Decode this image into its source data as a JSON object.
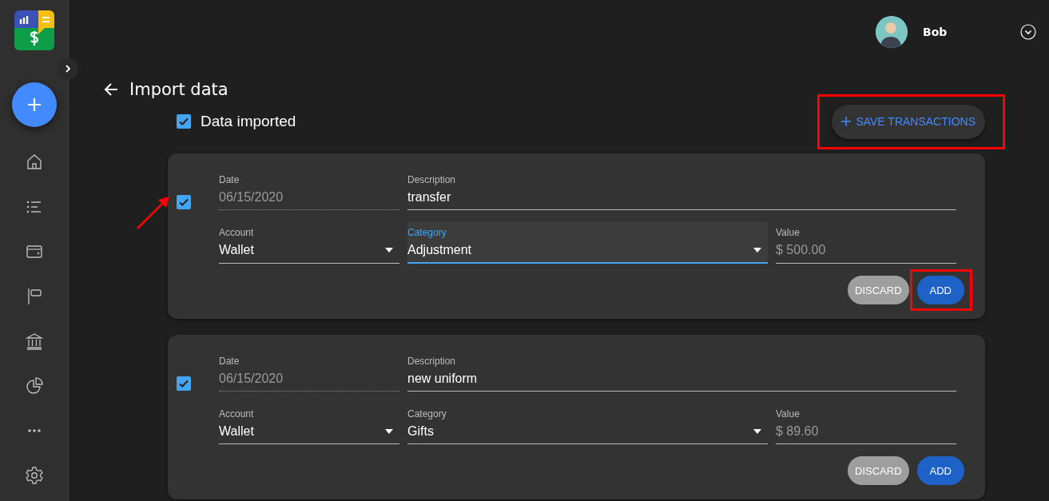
{
  "user": {
    "name": "Bob"
  },
  "page": {
    "title": "Import data"
  },
  "import_status": {
    "label": "Data imported",
    "checked": true
  },
  "save_button": {
    "label": "SAVE TRANSACTIONS",
    "highlighted": true
  },
  "transactions": [
    {
      "checked": true,
      "pointer_arrow": true,
      "rows": [
        [
          {
            "kind": "date",
            "label": "Date",
            "value": "06/15/2020",
            "focused": false
          },
          {
            "kind": "text",
            "label": "Description",
            "value": "transfer",
            "focused": false
          }
        ],
        [
          {
            "kind": "select",
            "label": "Account",
            "value": "Wallet",
            "focused": false
          },
          {
            "kind": "select",
            "label": "Category",
            "value": "Adjustment",
            "focused": true
          },
          {
            "kind": "amount",
            "label": "Value",
            "value": "$ 500.00",
            "focused": false
          }
        ]
      ],
      "discard_button": {
        "label": "DISCARD"
      },
      "add_button": {
        "label": "ADD",
        "highlighted": true
      }
    },
    {
      "checked": true,
      "pointer_arrow": false,
      "rows": [
        [
          {
            "kind": "date",
            "label": "Date",
            "value": "06/15/2020",
            "focused": false
          },
          {
            "kind": "text",
            "label": "Description",
            "value": "new uniform",
            "focused": false
          }
        ],
        [
          {
            "kind": "select",
            "label": "Account",
            "value": "Wallet",
            "focused": false
          },
          {
            "kind": "select",
            "label": "Category",
            "value": "Gifts",
            "focused": false
          },
          {
            "kind": "amount",
            "label": "Value",
            "value": "$ 89.60",
            "focused": false
          }
        ]
      ],
      "discard_button": {
        "label": "DISCARD"
      },
      "add_button": {
        "label": "ADD",
        "highlighted": false
      }
    }
  ]
}
